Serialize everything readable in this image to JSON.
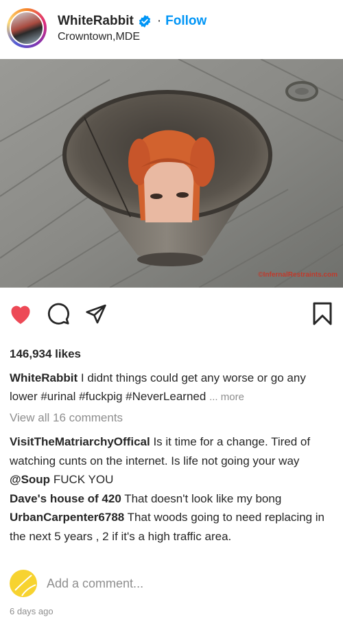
{
  "header": {
    "username": "WhiteRabbit",
    "separator": "·",
    "follow_label": "Follow",
    "location": "Crowntown,MDE",
    "verified_icon": "verified-badge-icon"
  },
  "photo": {
    "watermark": "©InfernalRestraints.com"
  },
  "actions": {
    "icons": [
      "heart-filled-icon",
      "comment-icon",
      "share-icon",
      "bookmark-icon"
    ],
    "heart_color": "#ed4956"
  },
  "post": {
    "likes": "146,934 likes",
    "caption_user": "WhiteRabbit",
    "caption_text": "I didnt things could get any worse or go any lower #urinal #fuckpig #NeverLearned",
    "more_label": "... more",
    "view_all": "View all 16 comments"
  },
  "comments": [
    {
      "user": "VisitTheMatriarchyOffical",
      "text": "Is it time for a change. Tired of watching cunts on the internet. Is life not going your way"
    },
    {
      "user": "@Soup",
      "text": "FUCK YOU"
    },
    {
      "user": "Dave's house of 420",
      "text": "That doesn't look like my bong"
    },
    {
      "user": "UrbanCarpenter6788",
      "text": "That woods going to need replacing in the next 5 years , 2 if it's a high traffic area."
    }
  ],
  "add_comment": {
    "placeholder": "Add a comment..."
  },
  "timestamp": "6 days ago",
  "colors": {
    "accent": "#0095f6",
    "heart": "#ed4956",
    "muted": "#8e8e8e",
    "avatar_yellow": "#f7d330"
  }
}
